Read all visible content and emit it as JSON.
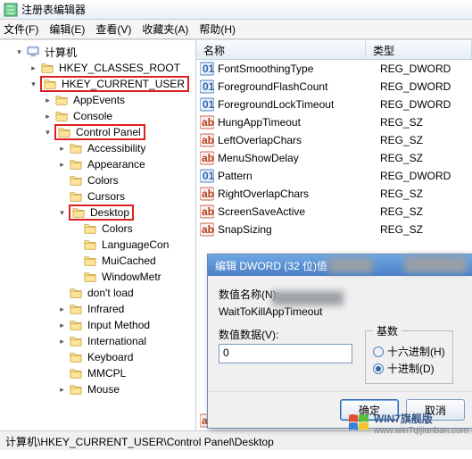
{
  "window": {
    "title": "注册表编辑器"
  },
  "menu": {
    "file": "文件(F)",
    "edit": "编辑(E)",
    "view": "查看(V)",
    "favorites": "收藏夹(A)",
    "help": "帮助(H)"
  },
  "tree": {
    "root": "计算机",
    "hkcr": "HKEY_CLASSES_ROOT",
    "hkcu": "HKEY_CURRENT_USER",
    "appevents": "AppEvents",
    "console": "Console",
    "controlpanel": "Control Panel",
    "accessibility": "Accessibility",
    "appearance": "Appearance",
    "colors": "Colors",
    "cursors": "Cursors",
    "desktop": "Desktop",
    "desktop_colors": "Colors",
    "languagecon": "LanguageCon",
    "muicached": "MuiCached",
    "windowmetr": "WindowMetr",
    "dontload": "don't load",
    "infrared": "Infrared",
    "inputmethod": "Input Method",
    "international": "International",
    "keyboard": "Keyboard",
    "mmcpl": "MMCPL",
    "mouse": "Mouse"
  },
  "columns": {
    "name": "名称",
    "type": "类型"
  },
  "values": [
    {
      "name": "FontSmoothingType",
      "type": "REG_DWORD",
      "icon": "dword"
    },
    {
      "name": "ForegroundFlashCount",
      "type": "REG_DWORD",
      "icon": "dword"
    },
    {
      "name": "ForegroundLockTimeout",
      "type": "REG_DWORD",
      "icon": "dword"
    },
    {
      "name": "HungAppTimeout",
      "type": "REG_SZ",
      "icon": "sz"
    },
    {
      "name": "LeftOverlapChars",
      "type": "REG_SZ",
      "icon": "sz"
    },
    {
      "name": "MenuShowDelay",
      "type": "REG_SZ",
      "icon": "sz"
    },
    {
      "name": "Pattern",
      "type": "REG_DWORD",
      "icon": "dword"
    },
    {
      "name": "RightOverlapChars",
      "type": "REG_SZ",
      "icon": "sz"
    },
    {
      "name": "ScreenSaveActive",
      "type": "REG_SZ",
      "icon": "sz"
    },
    {
      "name": "SnapSizing",
      "type": "REG_SZ",
      "icon": "sz"
    }
  ],
  "extra_value": {
    "name": "WaitToKillAppTimeout"
  },
  "dialog": {
    "title": "编辑 DWORD (32 位)值",
    "name_label": "数值名称(N):",
    "name_value": "WaitToKillAppTimeout",
    "data_label": "数值数据(V):",
    "data_value": "0",
    "base_label": "基数",
    "hex": "十六进制(H)",
    "dec": "十进制(D)",
    "ok": "确定",
    "cancel": "取消"
  },
  "statusbar": "计算机\\HKEY_CURRENT_USER\\Control Panel\\Desktop",
  "watermark": {
    "line1": "WIN7旗舰版",
    "line2": "www.win7qijianban.com"
  }
}
